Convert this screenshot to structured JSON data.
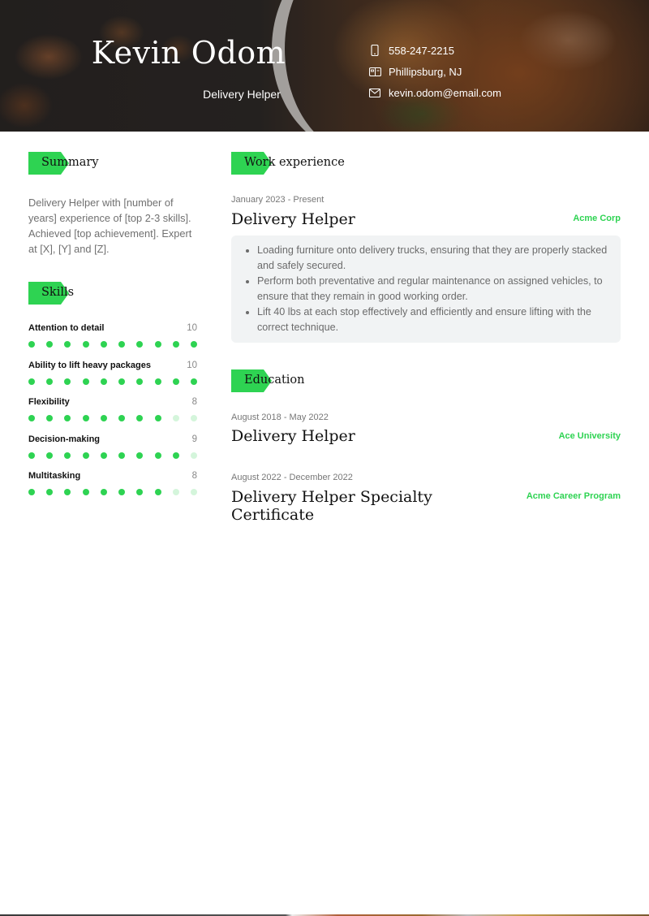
{
  "header": {
    "name": "Kevin Odom",
    "title": "Delivery Helper",
    "contacts": [
      {
        "icon": "phone-icon",
        "text": "558-247-2215"
      },
      {
        "icon": "location-icon",
        "text": "Phillipsburg, NJ"
      },
      {
        "icon": "email-icon",
        "text": "kevin.odom@email.com"
      }
    ]
  },
  "summary": {
    "heading": "Summary",
    "text": "Delivery Helper with [number of years] experience of [top 2-3 skills]. Achieved [top achievement]. Expert at [X], [Y] and [Z]."
  },
  "skills": {
    "heading": "Skills",
    "max": 10,
    "items": [
      {
        "name": "Attention to detail",
        "level": 10,
        "level_label": "10"
      },
      {
        "name": "Ability to lift heavy packages",
        "level": 10,
        "level_label": "10"
      },
      {
        "name": "Flexibility",
        "level": 8,
        "level_label": "8"
      },
      {
        "name": "Decision-making",
        "level": 9,
        "level_label": "9"
      },
      {
        "name": "Multitasking",
        "level": 8,
        "level_label": "8"
      }
    ]
  },
  "work": {
    "heading": "Work experience",
    "jobs": [
      {
        "dates": "January 2023 - Present",
        "title": "Delivery Helper",
        "company": "Acme Corp",
        "bullets": [
          "Loading furniture onto delivery trucks, ensuring that they are properly stacked and safely secured.",
          "Perform both preventative and regular maintenance on assigned vehicles, to ensure that they remain in good working order.",
          "Lift 40 lbs at each stop effectively and efficiently and ensure lifting with the correct technique."
        ]
      }
    ]
  },
  "education": {
    "heading": "Education",
    "items": [
      {
        "dates": "August 2018 - May 2022",
        "title": "Delivery Helper",
        "school": "Ace University"
      },
      {
        "dates": "August 2022 - December 2022",
        "title": "Delivery Helper Specialty Certificate",
        "school": "Acme Career Program"
      }
    ]
  },
  "colors": {
    "accent": "#2ed352",
    "accent_light": "#d4f5db",
    "bullet_bg": "#f1f3f4"
  }
}
